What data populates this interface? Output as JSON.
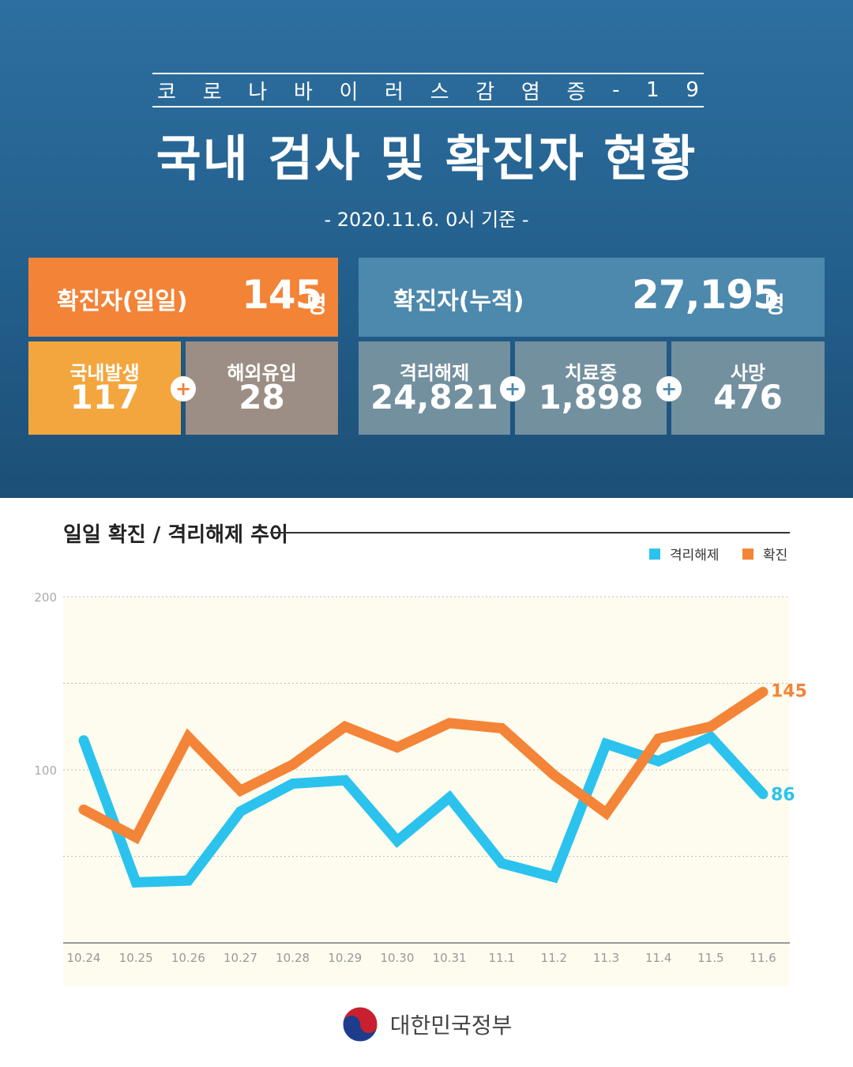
{
  "header": {
    "subtitle_chars": [
      "코",
      "로",
      "나",
      "바",
      "이",
      "러",
      "스",
      "감",
      "염",
      "증",
      "-",
      "1",
      "9"
    ],
    "title": "국내 검사 및 확진자 현황",
    "date": "- 2020.11.6. 0시 기준 -"
  },
  "daily": {
    "label": "확진자(일일)",
    "value": "145",
    "unit": "명"
  },
  "cumulative": {
    "label": "확진자(누적)",
    "value": "27,195",
    "unit": "명"
  },
  "breakdown": {
    "domestic": {
      "label": "국내발생",
      "value": "117"
    },
    "overseas": {
      "label": "해외유입",
      "value": "28"
    },
    "released": {
      "label": "격리해제",
      "value": "24,821"
    },
    "treating": {
      "label": "치료중",
      "value": "1,898"
    },
    "deaths": {
      "label": "사망",
      "value": "476"
    }
  },
  "plus_symbol": "+",
  "colors": {
    "released": "#2bc3ee",
    "confirmed": "#f48437",
    "orange_box": "#f38336",
    "yellow_box": "#f4a63e"
  },
  "chart_data": {
    "type": "line",
    "title": "일일 확진 / 격리해제 추이",
    "categories": [
      "10.24",
      "10.25",
      "10.26",
      "10.27",
      "10.28",
      "10.29",
      "10.30",
      "10.31",
      "11.1",
      "11.2",
      "11.3",
      "11.4",
      "11.5",
      "11.6"
    ],
    "series": [
      {
        "name": "격리해제",
        "color": "#2bc3ee",
        "values": [
          117,
          35,
          36,
          76,
          92,
          94,
          59,
          84,
          46,
          38,
          115,
          105,
          119,
          86
        ]
      },
      {
        "name": "확진",
        "color": "#f48437",
        "values": [
          77,
          61,
          119,
          88,
          103,
          125,
          113,
          127,
          124,
          97,
          75,
          118,
          125,
          145
        ]
      }
    ],
    "ylim": [
      0,
      200
    ],
    "yticks": [
      100,
      200
    ],
    "last_labels": [
      "145",
      "86"
    ],
    "legend": "top-right",
    "grid": true
  },
  "footer": {
    "text": "대한민국정부"
  }
}
